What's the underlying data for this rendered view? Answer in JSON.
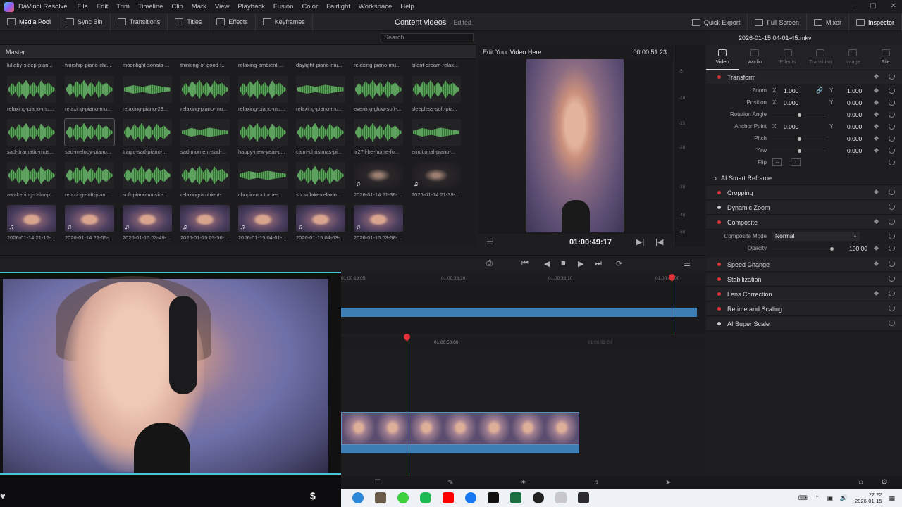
{
  "app": {
    "name": "DaVinci Resolve",
    "menu": [
      "File",
      "Edit",
      "Trim",
      "Timeline",
      "Clip",
      "Mark",
      "View",
      "Playback",
      "Fusion",
      "Color",
      "Fairlight",
      "Workspace",
      "Help"
    ]
  },
  "toolbar": {
    "left": [
      "Media Pool",
      "Sync Bin",
      "Transitions",
      "Titles",
      "Effects",
      "Keyframes"
    ],
    "project_name": "Content videos",
    "project_status": "Edited",
    "right": [
      "Quick Export",
      "Full Screen",
      "Mixer",
      "Inspector"
    ]
  },
  "media_pool": {
    "search_placeholder": "Search",
    "bin": "Master",
    "top_row_captions": [
      "lullaby-sleep-pian...",
      "worship-piano-chr...",
      "moonlight-sonata-...",
      "thinking-of-good-t...",
      "relaxing-ambient-...",
      "daylight-piano-mu...",
      "relaxing-piano-mu...",
      "silent-dream-relax..."
    ],
    "row1": [
      "relaxing-piano-mu...",
      "relaxing-piano-mu...",
      "relaxing-piano-29...",
      "relaxing-piano-mu...",
      "relaxing-piano-mu...",
      "relaxing-piano-mu...",
      "evening-glow-soft-...",
      "sleepless-soft-pia..."
    ],
    "row2": [
      "sad-dramatic-mus...",
      "sad-melody-piano...",
      "tragic-sad-piano-...",
      "sad-moment-sad-...",
      "happy-new-year-p...",
      "calm-christmas-pi...",
      "ix27ll-be-home-fo...",
      "emotional-piano-..."
    ],
    "row3": [
      "awakening-calm-p...",
      "relaxing-soft-pian...",
      "soft-piano-music-...",
      "relaxing-ambient-...",
      "chopin-nocturne-...",
      "snowflake-relaxin...",
      "2026-01-14 21-36-...",
      "2026-01-14 21-39-..."
    ],
    "row4": [
      "2026-01-14 21-12-...",
      "2026-01-14 22-05-...",
      "2026-01-15 03-49-...",
      "2026-01-15 03-56-...",
      "2026-01-15 04-01-...",
      "2026-01-15 04-03-...",
      "2026-01-15 03-58-..."
    ]
  },
  "viewer": {
    "title": "Edit Your Video Here",
    "duration": "00:00:51:23",
    "timecode": "01:00:49:17",
    "meter_labels": [
      "-5",
      "-10",
      "-15",
      "-20",
      "-30",
      "-40",
      "-50"
    ]
  },
  "inspector": {
    "filename": "2026-01-15 04-01-45.mkv",
    "tabs": [
      "Video",
      "Audio",
      "Effects",
      "Transition",
      "Image",
      "File"
    ],
    "transform": {
      "title": "Transform",
      "zoom_label": "Zoom",
      "zoom_x": "1.000",
      "zoom_y": "1.000",
      "position_label": "Position",
      "position_x": "0.000",
      "position_y": "0.000",
      "rotation_label": "Rotation Angle",
      "rotation": "0.000",
      "anchor_label": "Anchor Point",
      "anchor_x": "0.000",
      "anchor_y": "0.000",
      "pitch_label": "Pitch",
      "pitch": "0.000",
      "yaw_label": "Yaw",
      "yaw": "0.000",
      "flip_label": "Flip",
      "x": "X",
      "y": "Y"
    },
    "smart_reframe": "AI Smart Reframe",
    "cropping": "Cropping",
    "dynamic_zoom": "Dynamic Zoom",
    "composite": {
      "title": "Composite",
      "mode_label": "Composite Mode",
      "mode": "Normal",
      "opacity_label": "Opacity",
      "opacity": "100.00"
    },
    "sections": [
      "Speed Change",
      "Stabilization",
      "Lens Correction",
      "Retime and Scaling",
      "AI Super Scale"
    ]
  },
  "timeline": {
    "upper_ticks": [
      "01:00:19:05",
      "01:00:28:20",
      "01:00:38:10",
      "01:00:48:00"
    ],
    "lower_ticks": [
      "01:00:50:00",
      "01:00:52:00"
    ]
  },
  "taskbar": {
    "time": "22:22",
    "date": "2026-01-15"
  },
  "colors": {
    "accent_red": "#e0303a",
    "clip_blue": "#3d7fb5",
    "wave_green": "#5aa35a",
    "cam_border": "#47c6d8"
  }
}
